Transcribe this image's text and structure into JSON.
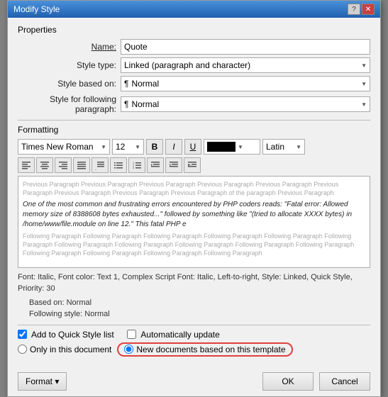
{
  "dialog": {
    "title": "Modify Style",
    "title_controls": {
      "help": "?",
      "close": "✕"
    }
  },
  "properties": {
    "label": "Properties",
    "name_label": "Name:",
    "name_value": "Quote",
    "style_type_label": "Style type:",
    "style_type_value": "Linked (paragraph and character)",
    "style_based_label": "Style based on:",
    "style_based_value": "Normal",
    "style_following_label": "Style for following paragraph:",
    "style_following_value": "Normal"
  },
  "formatting": {
    "label": "Formatting",
    "font": "Times New Roman",
    "size": "12",
    "bold": "B",
    "italic": "I",
    "underline": "U",
    "color_label": "",
    "language": "Latin",
    "align_buttons": [
      "≡",
      "≡",
      "≡",
      "≡",
      "≡",
      "≡",
      "≡",
      "≡",
      "≡",
      "≡"
    ],
    "preview": {
      "prev_text": "Previous Paragraph Previous Paragraph Previous Paragraph Previous Paragraph Previous Paragraph Previous Paragraph Previous Paragraph Previous Paragraph Previous Paragraph of the paragraph Previous Paragraph",
      "main_text": "One of the most common and frustrating errors encountered by PHP coders reads: \"Fatal error: Allowed memory size of 8388608 bytes exhausted...\" followed by something like \"(tried to allocate XXXX bytes) in /home/www/file.module on line 12.\" This fatal PHP e",
      "next_text": "Following Paragraph Following Paragraph Following Paragraph Following Paragraph Following Paragraph Following Paragraph Following Paragraph Following Paragraph Following Paragraph Following Paragraph Following Paragraph Following Paragraph Following Paragraph Following Paragraph Following Paragraph"
    }
  },
  "style_description": {
    "main": "Font: Italic, Font color: Text 1, Complex Script Font: Italic, Left-to-right, Style: Linked, Quick Style, Priority: 30",
    "based_on": "Based on: Normal",
    "following": "Following style: Normal"
  },
  "options": {
    "add_to_quick_style_label": "Add to Quick Style list",
    "auto_update_label": "Automatically update",
    "only_in_document_label": "Only in this document",
    "new_documents_label": "New documents based on this template",
    "add_to_quick_style_checked": true,
    "auto_update_checked": false,
    "only_in_document_selected": false,
    "new_documents_selected": true
  },
  "bottom": {
    "format_label": "Format ▾",
    "ok_label": "OK",
    "cancel_label": "Cancel"
  }
}
